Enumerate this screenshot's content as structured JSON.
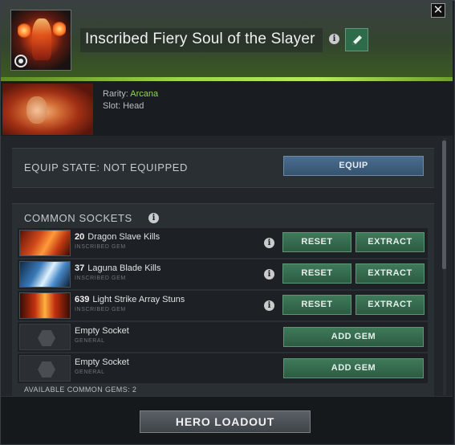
{
  "header": {
    "item_name": "Inscribed Fiery Soul of the Slayer",
    "close_glyph": "✕",
    "info_glyph": "i",
    "icons": {
      "inscribed": "inscribed-badge-icon",
      "info": "info-icon",
      "edit": "pencil-icon",
      "close": "close-icon"
    },
    "accent_color": "#9cd844"
  },
  "details": {
    "rarity_label": "Rarity: ",
    "rarity_value": "Arcana",
    "rarity_color": "#8ed84a",
    "slot_text": "Slot: Head"
  },
  "equip": {
    "label": "EQUIP STATE: NOT EQUIPPED",
    "button": "EQUIP"
  },
  "sockets": {
    "title": "COMMON SOCKETS",
    "rows": [
      {
        "count": "20",
        "name": "Dragon Slave Kills",
        "type": "INSCRIBED GEM",
        "reset": "RESET",
        "extract": "EXTRACT"
      },
      {
        "count": "37",
        "name": "Laguna Blade Kills",
        "type": "INSCRIBED GEM",
        "reset": "RESET",
        "extract": "EXTRACT"
      },
      {
        "count": "639",
        "name": "Light Strike Array Stuns",
        "type": "INSCRIBED GEM",
        "reset": "RESET",
        "extract": "EXTRACT"
      }
    ],
    "empty": [
      {
        "name": "Empty Socket",
        "type": "GENERAL",
        "button": "ADD GEM"
      },
      {
        "name": "Empty Socket",
        "type": "GENERAL",
        "button": "ADD GEM"
      }
    ],
    "available": "AVAILABLE COMMON GEMS: 2"
  },
  "footer": {
    "button": "HERO LOADOUT"
  }
}
